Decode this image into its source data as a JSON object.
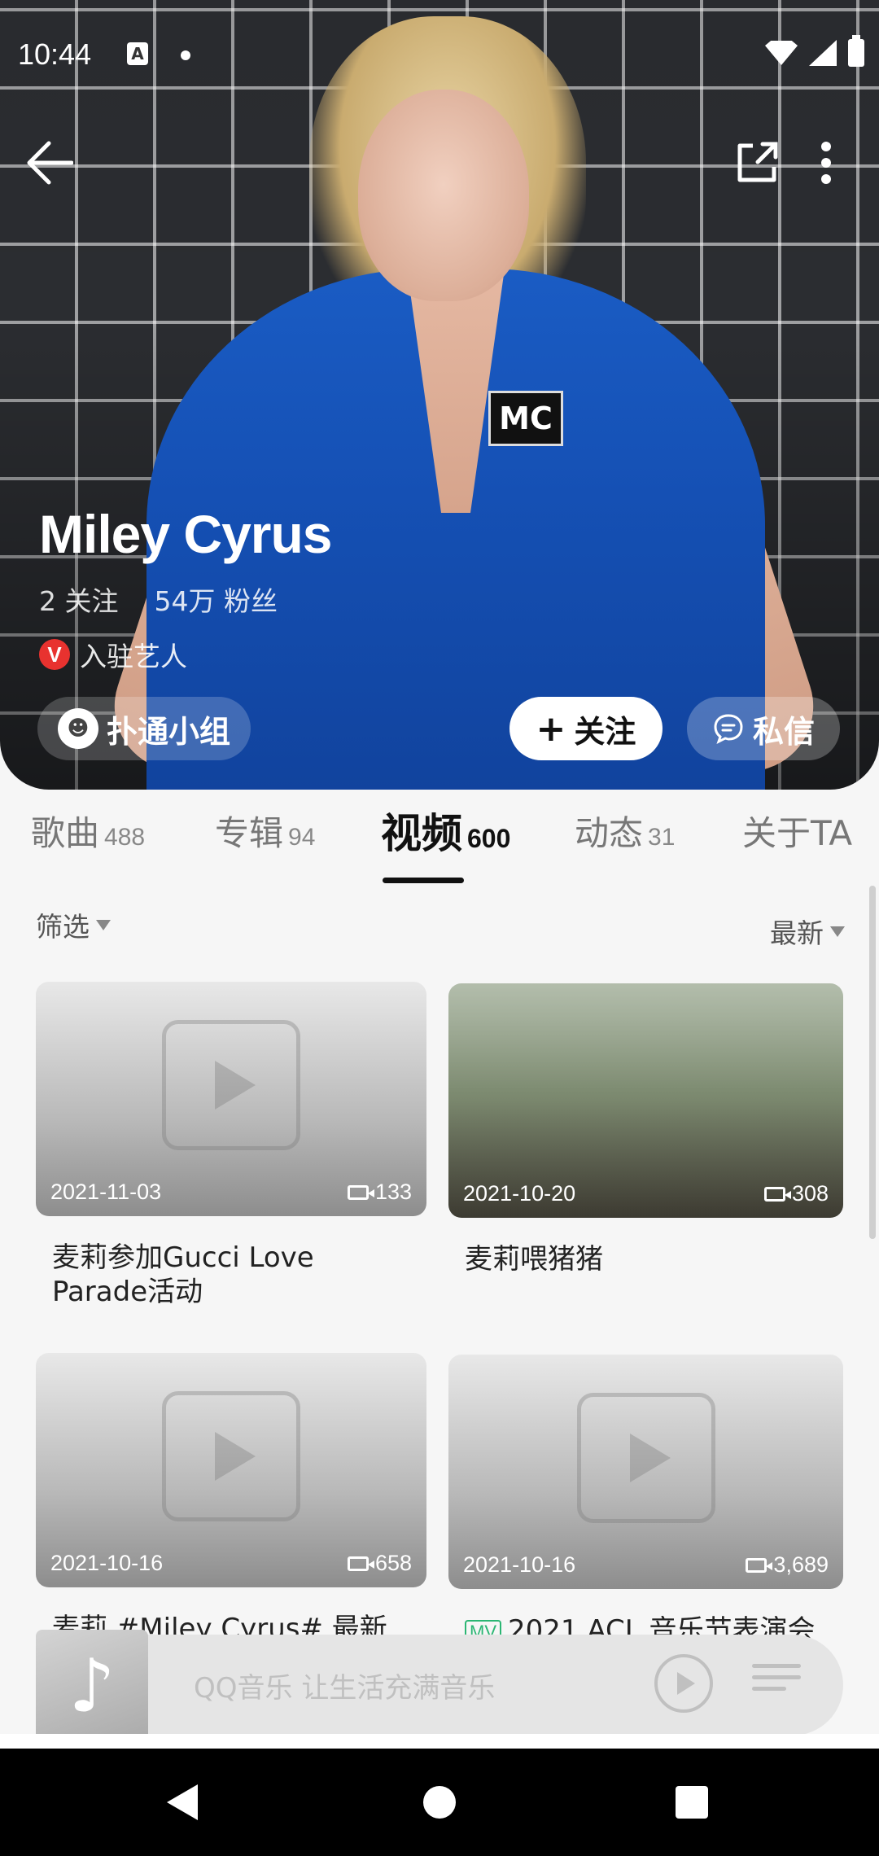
{
  "status": {
    "time": "10:44"
  },
  "hero": {
    "artist_name": "Miley Cyrus",
    "following": "2 关注",
    "fans": "54万 粉丝",
    "verified_label": "入驻艺人",
    "verified_badge": "V",
    "patch_text": "MC",
    "group_button": "扑通小组",
    "follow_button": "关注",
    "message_button": "私信"
  },
  "tabs": [
    {
      "label": "歌曲",
      "count": "488"
    },
    {
      "label": "专辑",
      "count": "94"
    },
    {
      "label": "视频",
      "count": "600"
    },
    {
      "label": "动态",
      "count": "31"
    },
    {
      "label": "关于TA",
      "count": ""
    }
  ],
  "active_tab": "视频",
  "filter": {
    "label": "筛选"
  },
  "sort": {
    "label": "最新"
  },
  "videos": [
    {
      "date": "2021-11-03",
      "views": "133",
      "title": "麦莉参加Gucci Love Parade活动",
      "mv": false
    },
    {
      "date": "2021-10-20",
      "views": "308",
      "title": "麦莉喂猪猪",
      "mv": false
    },
    {
      "date": "2021-10-16",
      "views": "658",
      "title": "麦莉 #Miley Cyrus# 最新",
      "mv": false
    },
    {
      "date": "2021-10-16",
      "views": "3,689",
      "title": "2021 ACL 音乐节表演会",
      "mv": true,
      "mv_label": "MV"
    }
  ],
  "player": {
    "slogan": "QQ音乐 让生活充满音乐"
  },
  "colors": {
    "accent_red": "#e8322f",
    "mv_green": "#2bb673"
  }
}
